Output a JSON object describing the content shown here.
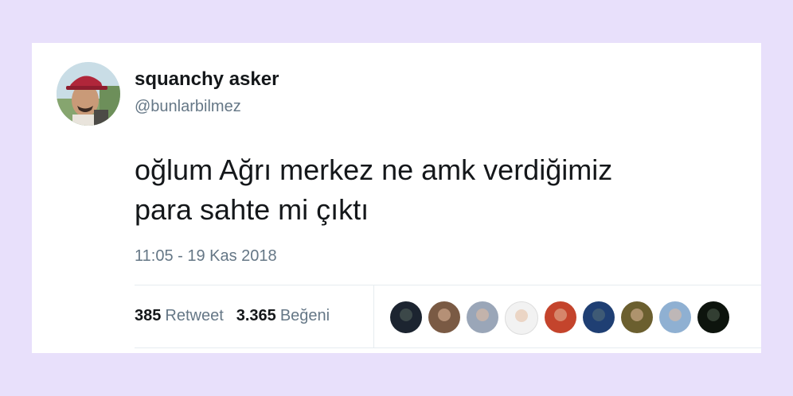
{
  "tweet": {
    "display_name": "squanchy asker",
    "handle": "@bunlarbilmez",
    "text_line1": "oğlum Ağrı merkez ne amk verdiğimiz",
    "text_line2": "para sahte mi çıktı",
    "timestamp": "11:05 - 19 Kas 2018"
  },
  "stats": {
    "retweet_count": "385",
    "retweet_label": "Retweet",
    "like_count": "3.365",
    "like_label": "Beğeni"
  },
  "likers": [
    {
      "name": "liker-avatar-1",
      "color": "#1c2430"
    },
    {
      "name": "liker-avatar-2",
      "color": "#7a5a44"
    },
    {
      "name": "liker-avatar-3",
      "color": "#9aa6b8"
    },
    {
      "name": "liker-avatar-4",
      "color": "#f2f2f2"
    },
    {
      "name": "liker-avatar-5",
      "color": "#c4442c"
    },
    {
      "name": "liker-avatar-6",
      "color": "#1f3f73"
    },
    {
      "name": "liker-avatar-7",
      "color": "#6b5f2f"
    },
    {
      "name": "liker-avatar-8",
      "color": "#8fb0d2"
    },
    {
      "name": "liker-avatar-9",
      "color": "#0d140d"
    }
  ],
  "colors": {
    "page_background": "#e8e0fb",
    "card_background": "#ffffff",
    "primary_text": "#14171a",
    "secondary_text": "#657786",
    "divider": "#e6ecf0"
  }
}
